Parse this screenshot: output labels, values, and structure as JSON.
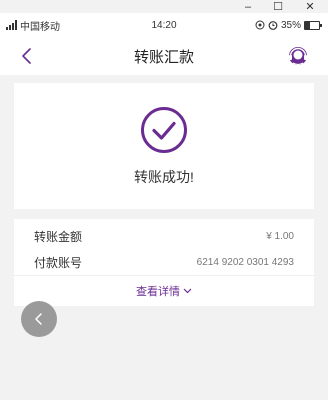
{
  "window": {
    "minimize": "–",
    "maximize": "☐",
    "close": "✕"
  },
  "status_bar": {
    "carrier": "中国移动",
    "time": "14:20",
    "battery": "35%",
    "battery_level": 0.35
  },
  "nav": {
    "title": "转账汇款"
  },
  "result": {
    "message": "转账成功!"
  },
  "details": {
    "amount_label": "转账金额",
    "amount_value": "¥ 1.00",
    "account_label": "付款账号",
    "account_value": "6214 9202 0301 4293",
    "view_details": "查看详情"
  },
  "colors": {
    "accent": "#6a2c91",
    "background": "#f2f2f2"
  }
}
